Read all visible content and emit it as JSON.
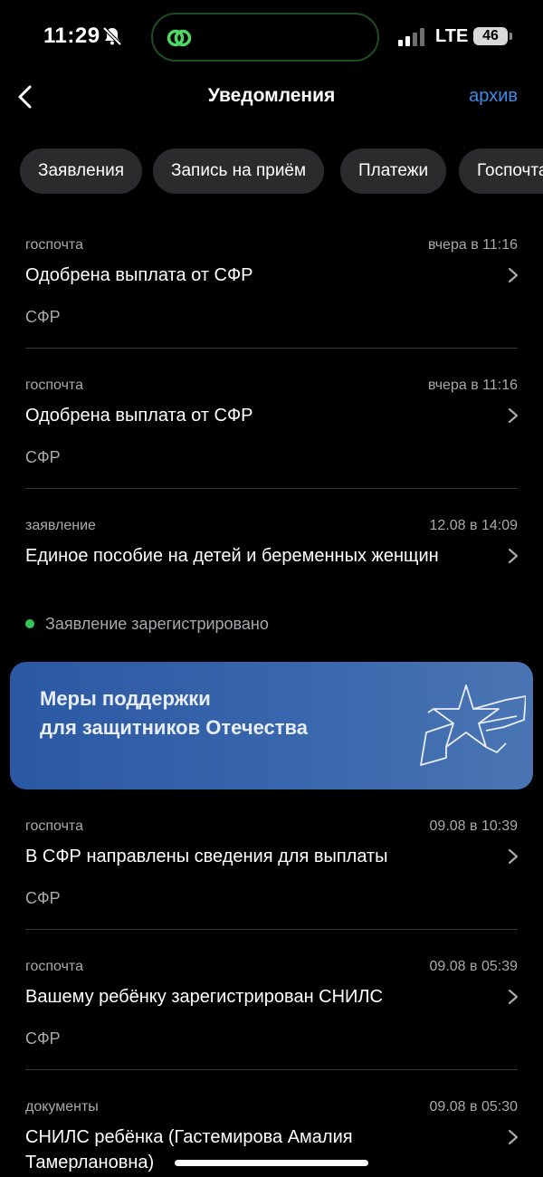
{
  "status_bar": {
    "time": "11:29",
    "network": "LTE",
    "battery": "46",
    "mute_icon": "bell-slash-icon",
    "island_icon": "link-icon"
  },
  "nav": {
    "title": "Уведомления",
    "archive_label": "архив",
    "back_icon": "chevron-left-icon"
  },
  "filters": [
    "Заявления",
    "Запись на приём",
    "Платежи",
    "Госпочта"
  ],
  "notifications": [
    {
      "category": "госпочта",
      "date": "вчера в 11:16",
      "title": "Одобрена выплата от СФР",
      "subtitle": "СФР"
    },
    {
      "category": "госпочта",
      "date": "вчера в 11:16",
      "title": "Одобрена выплата от СФР",
      "subtitle": "СФР"
    },
    {
      "category": "заявление",
      "date": "12.08 в 14:09",
      "title": "Единое пособие на детей и беременных женщин",
      "status": "Заявление зарегистрировано",
      "status_color": "#33c759"
    },
    {
      "category": "госпочта",
      "date": "09.08 в 10:39",
      "title": "В СФР направлены сведения для выплаты",
      "subtitle": "СФР"
    },
    {
      "category": "госпочта",
      "date": "09.08 в 05:39",
      "title": "Вашему ребёнку зарегистрирован СНИЛС",
      "subtitle": "СФР"
    },
    {
      "category": "документы",
      "date": "09.08 в 05:30",
      "title": "СНИЛС ребёнка (Гастемирова Амалия Тамерлановна)"
    }
  ],
  "banner": {
    "line1": "Меры поддержки",
    "line2": "для защитников Отечества",
    "icon": "star-icon"
  },
  "colors": {
    "accent": "#3d8ce6",
    "background": "#000000",
    "chip": "#2b2b2e",
    "banner": "#2b58a3"
  }
}
